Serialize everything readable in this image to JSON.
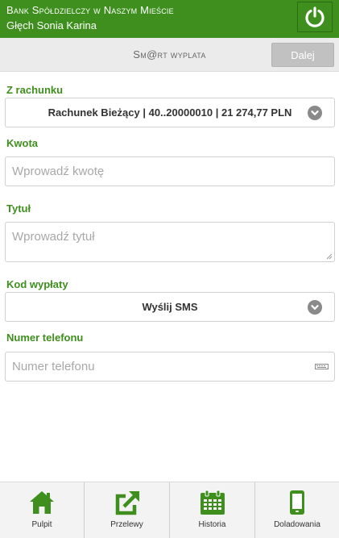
{
  "header": {
    "bank_name": "Bank Spółdzielczy w Naszym Mieście",
    "user_name": "Głęch Sonia Karina",
    "logout_icon": "power-icon"
  },
  "toolbar": {
    "title": "Sm@rt wyplata",
    "next_label": "Dalej"
  },
  "form": {
    "account": {
      "label": "Z rachunku",
      "value": "Rachunek Bieżący | 40..20000010 | 21 274,77 PLN"
    },
    "amount": {
      "label": "Kwota",
      "placeholder": "Wprowadź kwotę",
      "value": ""
    },
    "title": {
      "label": "Tytuł",
      "placeholder": "Wprowadź tytuł",
      "value": ""
    },
    "payout_code": {
      "label": "Kod wypłaty",
      "value": "Wyślij SMS"
    },
    "phone": {
      "label": "Numer telefonu",
      "placeholder": "Numer telefonu",
      "value": ""
    }
  },
  "nav": [
    {
      "label": "Pulpit",
      "icon": "home-icon"
    },
    {
      "label": "Przelewy",
      "icon": "transfer-icon"
    },
    {
      "label": "Historia",
      "icon": "calendar-icon"
    },
    {
      "label": "Doladowania",
      "icon": "phone-icon"
    }
  ],
  "colors": {
    "brand_green": "#3e8f1d",
    "header_text": "#ffffff",
    "button_disabled": "#c1c1c1"
  }
}
